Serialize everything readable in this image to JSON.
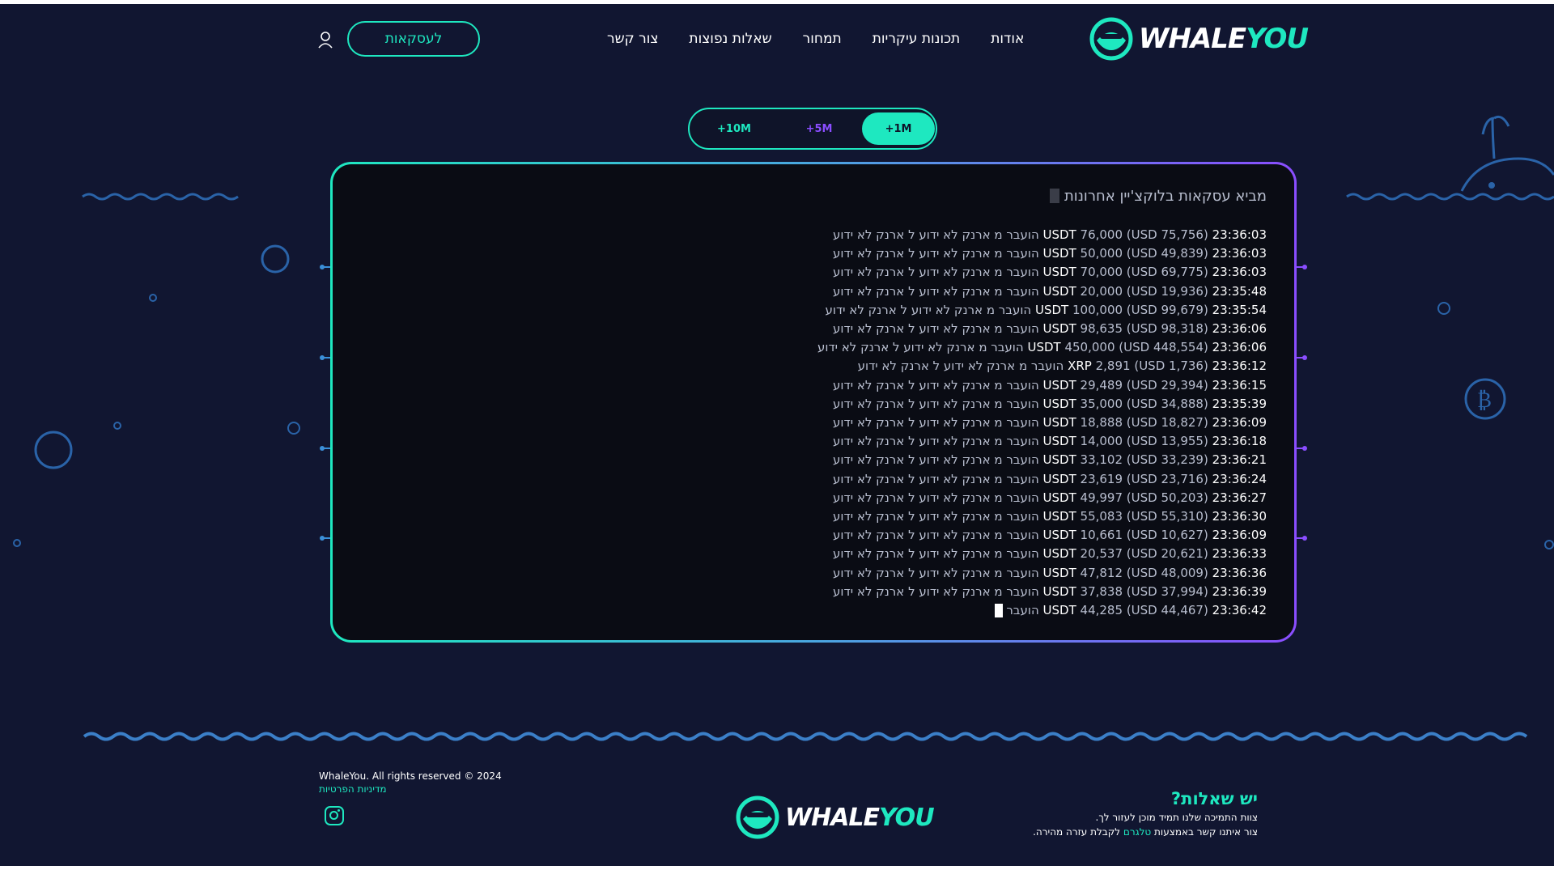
{
  "brand": {
    "word_light": "WHALE",
    "word_accent": "YOU",
    "accent_color": "#1ee8c0",
    "purple_color": "#8a4dff"
  },
  "nav": {
    "items": [
      "אודות",
      "תכונות עיקריות",
      "תמחור",
      "שאלות נפוצות",
      "צור קשר"
    ],
    "deals_button": "לעסקאות",
    "user_icon": "user-icon"
  },
  "filters": {
    "pill_10m": "+10M",
    "pill_5m": "+5M",
    "pill_1m": "+1M",
    "active": "+1M"
  },
  "terminal": {
    "header": "מביא עסקאות בלוקצ'יין אחרונות",
    "transactions": [
      {
        "time": "23:36:03",
        "token": "USDT",
        "amount": "76,000",
        "usd": "75,756"
      },
      {
        "time": "23:36:03",
        "token": "USDT",
        "amount": "50,000",
        "usd": "49,839"
      },
      {
        "time": "23:36:03",
        "token": "USDT",
        "amount": "70,000",
        "usd": "69,775"
      },
      {
        "time": "23:35:48",
        "token": "USDT",
        "amount": "20,000",
        "usd": "19,936"
      },
      {
        "time": "23:35:54",
        "token": "USDT",
        "amount": "100,000",
        "usd": "99,679"
      },
      {
        "time": "23:36:06",
        "token": "USDT",
        "amount": "98,635",
        "usd": "98,318"
      },
      {
        "time": "23:36:06",
        "token": "USDT",
        "amount": "450,000",
        "usd": "448,554"
      },
      {
        "time": "23:36:12",
        "token": "XRP",
        "amount": "2,891",
        "usd": "1,736"
      },
      {
        "time": "23:36:15",
        "token": "USDT",
        "amount": "29,489",
        "usd": "29,394"
      },
      {
        "time": "23:35:39",
        "token": "USDT",
        "amount": "35,000",
        "usd": "34,888"
      },
      {
        "time": "23:36:09",
        "token": "USDT",
        "amount": "18,888",
        "usd": "18,827"
      },
      {
        "time": "23:36:18",
        "token": "USDT",
        "amount": "14,000",
        "usd": "13,955"
      },
      {
        "time": "23:36:21",
        "token": "USDT",
        "amount": "33,102",
        "usd": "33,239"
      },
      {
        "time": "23:36:24",
        "token": "USDT",
        "amount": "23,619",
        "usd": "23,716"
      },
      {
        "time": "23:36:27",
        "token": "USDT",
        "amount": "49,997",
        "usd": "50,203"
      },
      {
        "time": "23:36:30",
        "token": "USDT",
        "amount": "55,083",
        "usd": "55,310"
      },
      {
        "time": "23:36:09",
        "token": "USDT",
        "amount": "10,661",
        "usd": "10,627"
      },
      {
        "time": "23:36:33",
        "token": "USDT",
        "amount": "20,537",
        "usd": "20,621"
      },
      {
        "time": "23:36:36",
        "token": "USDT",
        "amount": "47,812",
        "usd": "48,009"
      },
      {
        "time": "23:36:39",
        "token": "USDT",
        "amount": "37,838",
        "usd": "37,994"
      }
    ],
    "transfer_text": "הועבר מ ארנק לא ידוע ל ארנק לא ידוע",
    "last_line": {
      "time": "23:36:42",
      "token": "USDT",
      "amount": "44,285",
      "usd": "44,467",
      "text": "הועבר"
    }
  },
  "footer": {
    "copyright": "WhaleYou. All rights reserved © 2024",
    "privacy": "מדיניות הפרטיות",
    "instagram_icon": "instagram-icon",
    "questions_title": "יש שאלות?",
    "support_line": "צוות התמיכה שלנו תמיד מוכן לעזור לך.",
    "contact_pre": "צור איתנו קשר באמצעות",
    "telegram": "טלגרם",
    "contact_post": "לקבלת עזרה מהירה."
  }
}
